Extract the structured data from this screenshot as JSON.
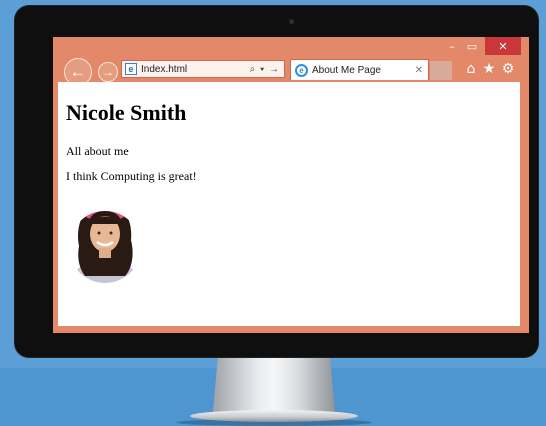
{
  "browser": {
    "window_controls": {
      "minimize": "–",
      "maximize": "▭",
      "close": "✕"
    },
    "nav": {
      "back_icon": "←",
      "forward_icon": "→"
    },
    "address_bar": {
      "url": "Index.html",
      "page_icon": "e",
      "tools": "⌕ ▾ →"
    },
    "tab": {
      "title": "About Me Page",
      "icon": "e",
      "close": "✕"
    },
    "toolbar_icons": {
      "home": "⌂",
      "favorites": "★",
      "settings": "⚙"
    }
  },
  "page": {
    "heading": "Nicole Smith",
    "paragraphs": [
      "All about me",
      "I think Computing is great!"
    ]
  },
  "colors": {
    "browser_chrome": "#e3896a",
    "close_button": "#c9373a",
    "background": "#5b9fd6"
  }
}
